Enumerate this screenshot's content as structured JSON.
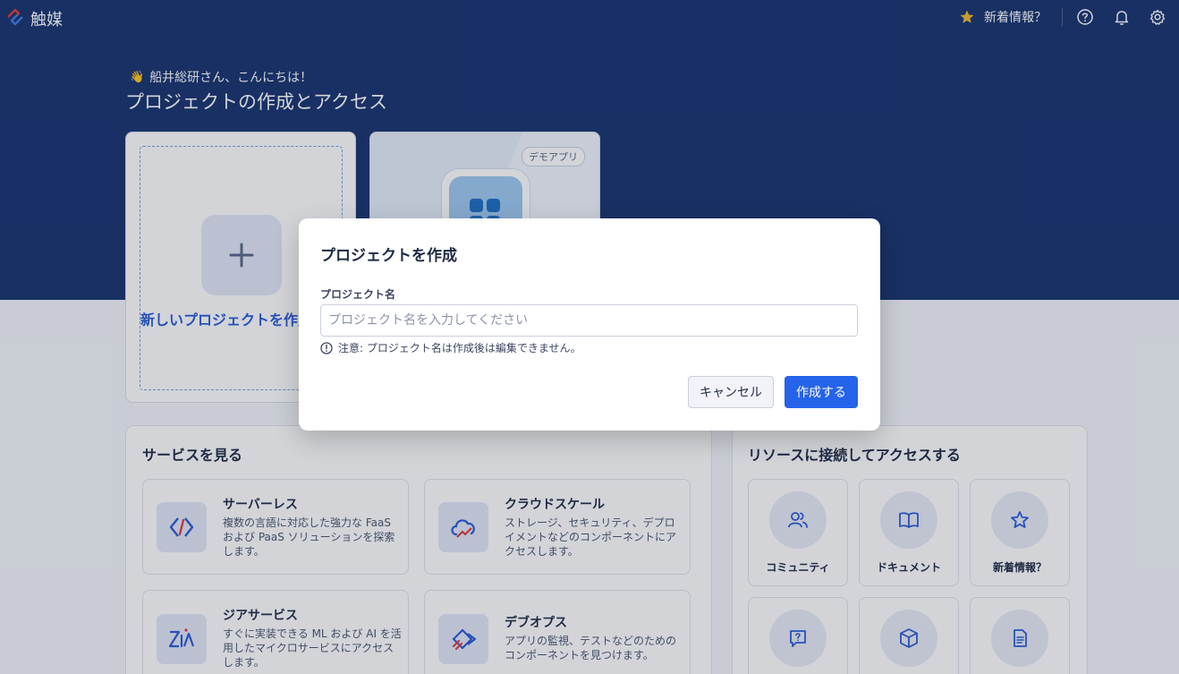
{
  "app": {
    "brand": "触媒"
  },
  "topbar": {
    "whats_new": "新着情報？"
  },
  "hero": {
    "greeting": "船井総研さん、こんにちは！",
    "wave_emoji": "👋",
    "title": "プロジェクトの作成とアクセス"
  },
  "projects": {
    "new_label": "新しいプロジェクトを作成",
    "demo_badge": "デモアプリ"
  },
  "services": {
    "title": "サービスを見る",
    "items": [
      {
        "title": "サーバーレス",
        "desc": "複数の言語に対応した強力な FaaS および PaaS ソリューションを探索します。"
      },
      {
        "title": "クラウドスケール",
        "desc": "ストレージ、セキュリティ、デプロイメントなどのコンポーネントにアクセスします。"
      },
      {
        "title": "ジアサービス",
        "desc": "すぐに実装できる ML および AI を活用したマイクロサービスにアクセスします。"
      },
      {
        "title": "デブオプス",
        "desc": "アプリの監視、テストなどのためのコンポーネントを見つけます。"
      }
    ]
  },
  "resources": {
    "title": "リソースに接続してアクセスする",
    "items": [
      {
        "label": "コミュニティ"
      },
      {
        "label": "ドキュメント"
      },
      {
        "label": "新着情報？"
      }
    ]
  },
  "modal": {
    "title": "プロジェクトを作成",
    "field_label": "プロジェクト名",
    "input_value": "",
    "input_placeholder": "プロジェクト名を入力してください",
    "note": "注意: プロジェクト名は作成後は編集できません。",
    "cancel_label": "キャンセル",
    "create_label": "作成する"
  },
  "colors": {
    "hero_bg": "#17326f",
    "primary": "#2563eb",
    "accent_star": "#f5b82e"
  }
}
